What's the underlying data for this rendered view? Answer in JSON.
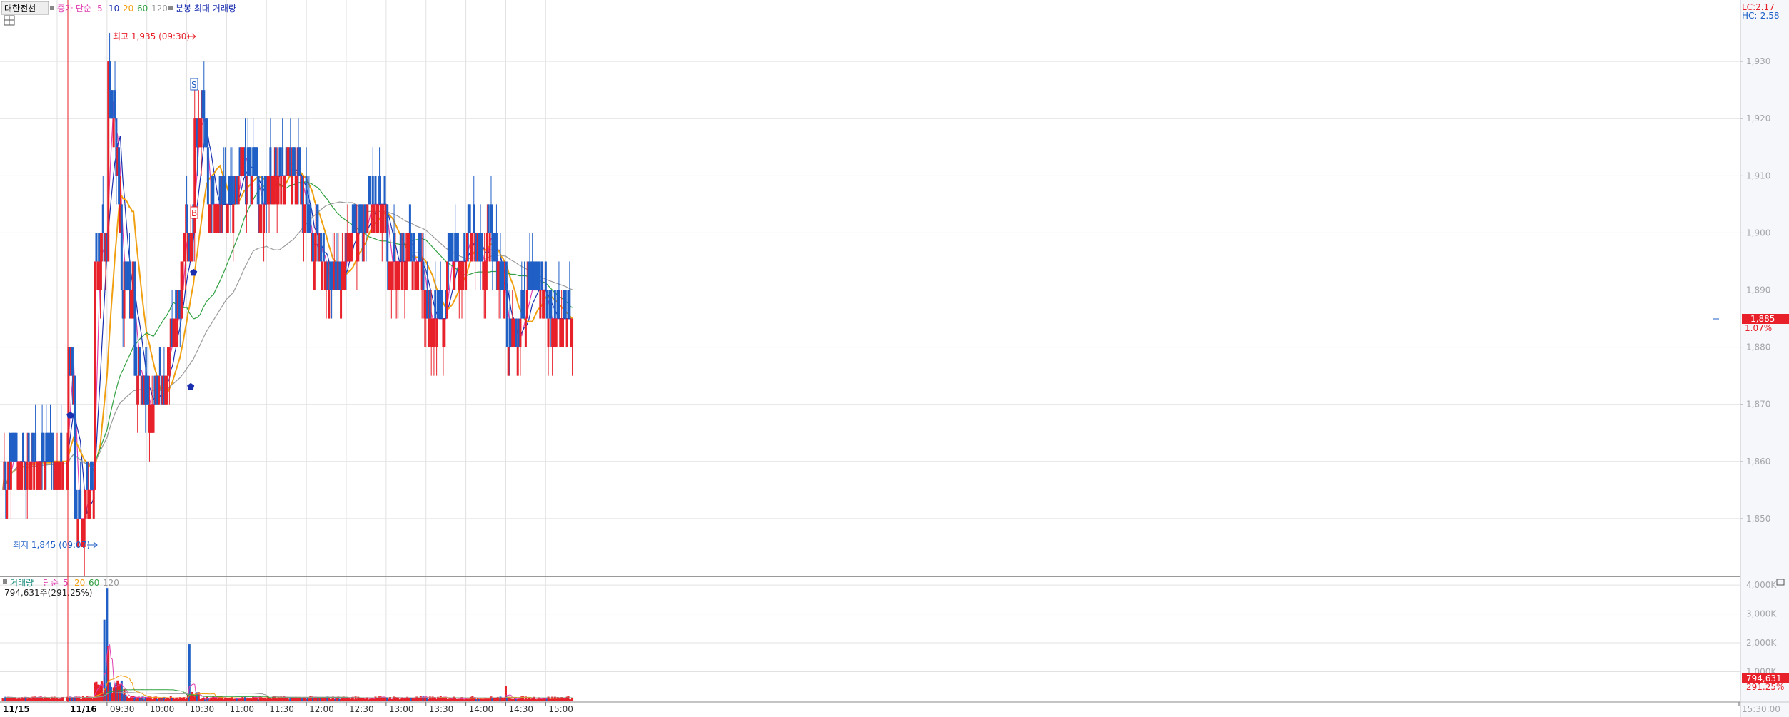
{
  "legend": {
    "symbol": "대한전선",
    "ma_label": "종가 단순",
    "ma_periods": [
      "5",
      "10",
      "20",
      "60",
      "120"
    ],
    "extra": "분봉 최대 거래량"
  },
  "volume_legend": {
    "label": "거래량",
    "ma_label": "단순",
    "ma_periods": [
      "5",
      "20",
      "60",
      "120"
    ],
    "value": "794,631주(291.25%)"
  },
  "top_right": {
    "lc": "LC:2.17",
    "hc": "HC:-2.58"
  },
  "annotations": {
    "high": "최고 1,935 (09:30)",
    "low": "최저 1,845 (09:07)",
    "badge_s": "S",
    "badge_b": "B"
  },
  "current_price": {
    "price": "1,885",
    "pct": "1.07%"
  },
  "current_volume": {
    "value": "794,631",
    "pct": "291.25%"
  },
  "x_axis": {
    "dates": [
      "11/15",
      "11/16"
    ],
    "times": [
      "09:30",
      "10:00",
      "10:30",
      "11:00",
      "11:30",
      "12:00",
      "12:30",
      "13:00",
      "13:30",
      "14:00",
      "14:30",
      "15:00",
      "15:30:00"
    ]
  },
  "colors": {
    "up": "#e8202a",
    "down": "#1f5fc6",
    "ma5": "#e040b0",
    "ma10": "#1a2fb0",
    "ma20": "#f0a010",
    "ma60": "#30a040",
    "ma120": "#9a9a9a"
  },
  "chart_data": {
    "type": "candlestick",
    "interval": "1-minute",
    "price_axis": {
      "ylim": [
        1840,
        1940
      ],
      "ticks": [
        1850,
        1860,
        1870,
        1880,
        1890,
        1900,
        1910,
        1920,
        1930
      ]
    },
    "volume_axis": {
      "ylim": [
        0,
        4200
      ],
      "unit": "K",
      "ticks": [
        "1,000K",
        "2,000K",
        "3,000K",
        "4,000K"
      ]
    },
    "x_ticks": [
      "09:30",
      "10:00",
      "10:30",
      "11:00",
      "11:30",
      "12:00",
      "12:30",
      "13:00",
      "13:30",
      "14:00",
      "14:30",
      "15:00",
      "15:30:00"
    ],
    "segments": [
      {
        "time": "11/15 close",
        "o": 1860,
        "c": 1858,
        "h": 1865,
        "l": 1855
      },
      {
        "time": "09:00",
        "o": 1860,
        "c": 1880,
        "h": 1880,
        "l": 1855
      },
      {
        "time": "09:05",
        "o": 1875,
        "c": 1850,
        "h": 1875,
        "l": 1845
      },
      {
        "time": "09:07",
        "o": 1850,
        "c": 1850,
        "h": 1855,
        "l": 1845
      },
      {
        "time": "09:20",
        "o": 1855,
        "c": 1890,
        "h": 1895,
        "l": 1850
      },
      {
        "time": "09:30",
        "o": 1900,
        "c": 1930,
        "h": 1935,
        "l": 1900
      },
      {
        "time": "09:40",
        "o": 1905,
        "c": 1890,
        "h": 1910,
        "l": 1885
      },
      {
        "time": "09:50",
        "o": 1890,
        "c": 1875,
        "h": 1895,
        "l": 1870
      },
      {
        "time": "10:00",
        "o": 1875,
        "c": 1870,
        "h": 1880,
        "l": 1865
      },
      {
        "time": "10:15",
        "o": 1875,
        "c": 1880,
        "h": 1885,
        "l": 1875
      },
      {
        "time": "10:25",
        "o": 1885,
        "c": 1895,
        "h": 1895,
        "l": 1880
      },
      {
        "time": "10:35",
        "o": 1900,
        "c": 1920,
        "h": 1925,
        "l": 1890
      },
      {
        "time": "10:45",
        "o": 1915,
        "c": 1905,
        "h": 1915,
        "l": 1895
      },
      {
        "time": "11:00",
        "o": 1905,
        "c": 1900,
        "h": 1910,
        "l": 1895
      },
      {
        "time": "11:10",
        "o": 1910,
        "c": 1915,
        "h": 1920,
        "l": 1905
      },
      {
        "time": "11:30",
        "o": 1905,
        "c": 1910,
        "h": 1910,
        "l": 1900
      },
      {
        "time": "11:45",
        "o": 1910,
        "c": 1915,
        "h": 1915,
        "l": 1905
      },
      {
        "time": "12:00",
        "o": 1905,
        "c": 1900,
        "h": 1910,
        "l": 1895
      },
      {
        "time": "12:15",
        "o": 1895,
        "c": 1890,
        "h": 1900,
        "l": 1890
      },
      {
        "time": "12:30",
        "o": 1895,
        "c": 1900,
        "h": 1900,
        "l": 1895
      },
      {
        "time": "12:45",
        "o": 1900,
        "c": 1905,
        "h": 1905,
        "l": 1900
      },
      {
        "time": "13:00",
        "o": 1905,
        "c": 1895,
        "h": 1905,
        "l": 1890
      },
      {
        "time": "13:15",
        "o": 1895,
        "c": 1900,
        "h": 1900,
        "l": 1890
      },
      {
        "time": "13:30",
        "o": 1890,
        "c": 1885,
        "h": 1895,
        "l": 1885
      },
      {
        "time": "13:45",
        "o": 1885,
        "c": 1895,
        "h": 1895,
        "l": 1885
      },
      {
        "time": "14:00",
        "o": 1895,
        "c": 1900,
        "h": 1905,
        "l": 1890
      },
      {
        "time": "14:15",
        "o": 1895,
        "c": 1900,
        "h": 1900,
        "l": 1895
      },
      {
        "time": "14:30",
        "o": 1890,
        "c": 1880,
        "h": 1890,
        "l": 1880
      },
      {
        "time": "14:45",
        "o": 1885,
        "c": 1890,
        "h": 1890,
        "l": 1885
      },
      {
        "time": "15:00",
        "o": 1890,
        "c": 1885,
        "h": 1890,
        "l": 1885
      },
      {
        "time": "15:20",
        "o": 1885,
        "c": 1885,
        "h": 1895,
        "l": 1885
      }
    ],
    "series": [
      {
        "name": "5",
        "type": "moving_average"
      },
      {
        "name": "10",
        "type": "moving_average"
      },
      {
        "name": "20",
        "type": "moving_average"
      },
      {
        "name": "60",
        "type": "moving_average"
      },
      {
        "name": "120",
        "type": "moving_average"
      }
    ],
    "volume_peaks": [
      {
        "time": "09:30",
        "value": 3900
      },
      {
        "time": "10:32",
        "value": 1950
      },
      {
        "time": "14:30",
        "value": 500
      },
      {
        "time": "15:30",
        "value": 794.631
      }
    ],
    "grid": true
  }
}
